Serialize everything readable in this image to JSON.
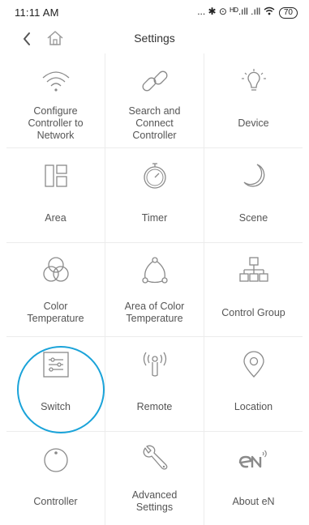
{
  "status_bar": {
    "time": "11:11 AM",
    "indicators": "... ✱ ⊙ ᴴᴰ.ıll .ıll ",
    "battery": "70"
  },
  "header": {
    "title": "Settings",
    "back_icon": "chevron-left-icon",
    "home_icon": "home-icon"
  },
  "grid": {
    "items": [
      {
        "label": "Configure\nController to\nNetwork",
        "icon": "wifi-icon"
      },
      {
        "label": "Search and\nConnect\nController",
        "icon": "link-icon"
      },
      {
        "label": "Device",
        "icon": "bulb-icon"
      },
      {
        "label": "Area",
        "icon": "layout-icon"
      },
      {
        "label": "Timer",
        "icon": "stopwatch-icon"
      },
      {
        "label": "Scene",
        "icon": "moon-icon"
      },
      {
        "label": "Color\nTemperature",
        "icon": "color-circles-icon"
      },
      {
        "label": "Area of Color\nTemperature",
        "icon": "triangle-nodes-icon"
      },
      {
        "label": "Control Group",
        "icon": "hierarchy-icon"
      },
      {
        "label": "Switch",
        "icon": "switch-panel-icon"
      },
      {
        "label": "Remote",
        "icon": "remote-antenna-icon"
      },
      {
        "label": "Location",
        "icon": "location-pin-icon"
      },
      {
        "label": "Controller",
        "icon": "controller-circle-icon"
      },
      {
        "label": "Advanced\nSettings",
        "icon": "wrench-icon"
      },
      {
        "label": "About eN",
        "icon": "en-logo-icon"
      }
    ]
  },
  "colors": {
    "icon_stroke": "#8a8a8a",
    "label": "#555555",
    "divider": "#ececec",
    "highlight": "#1aa3d9"
  }
}
